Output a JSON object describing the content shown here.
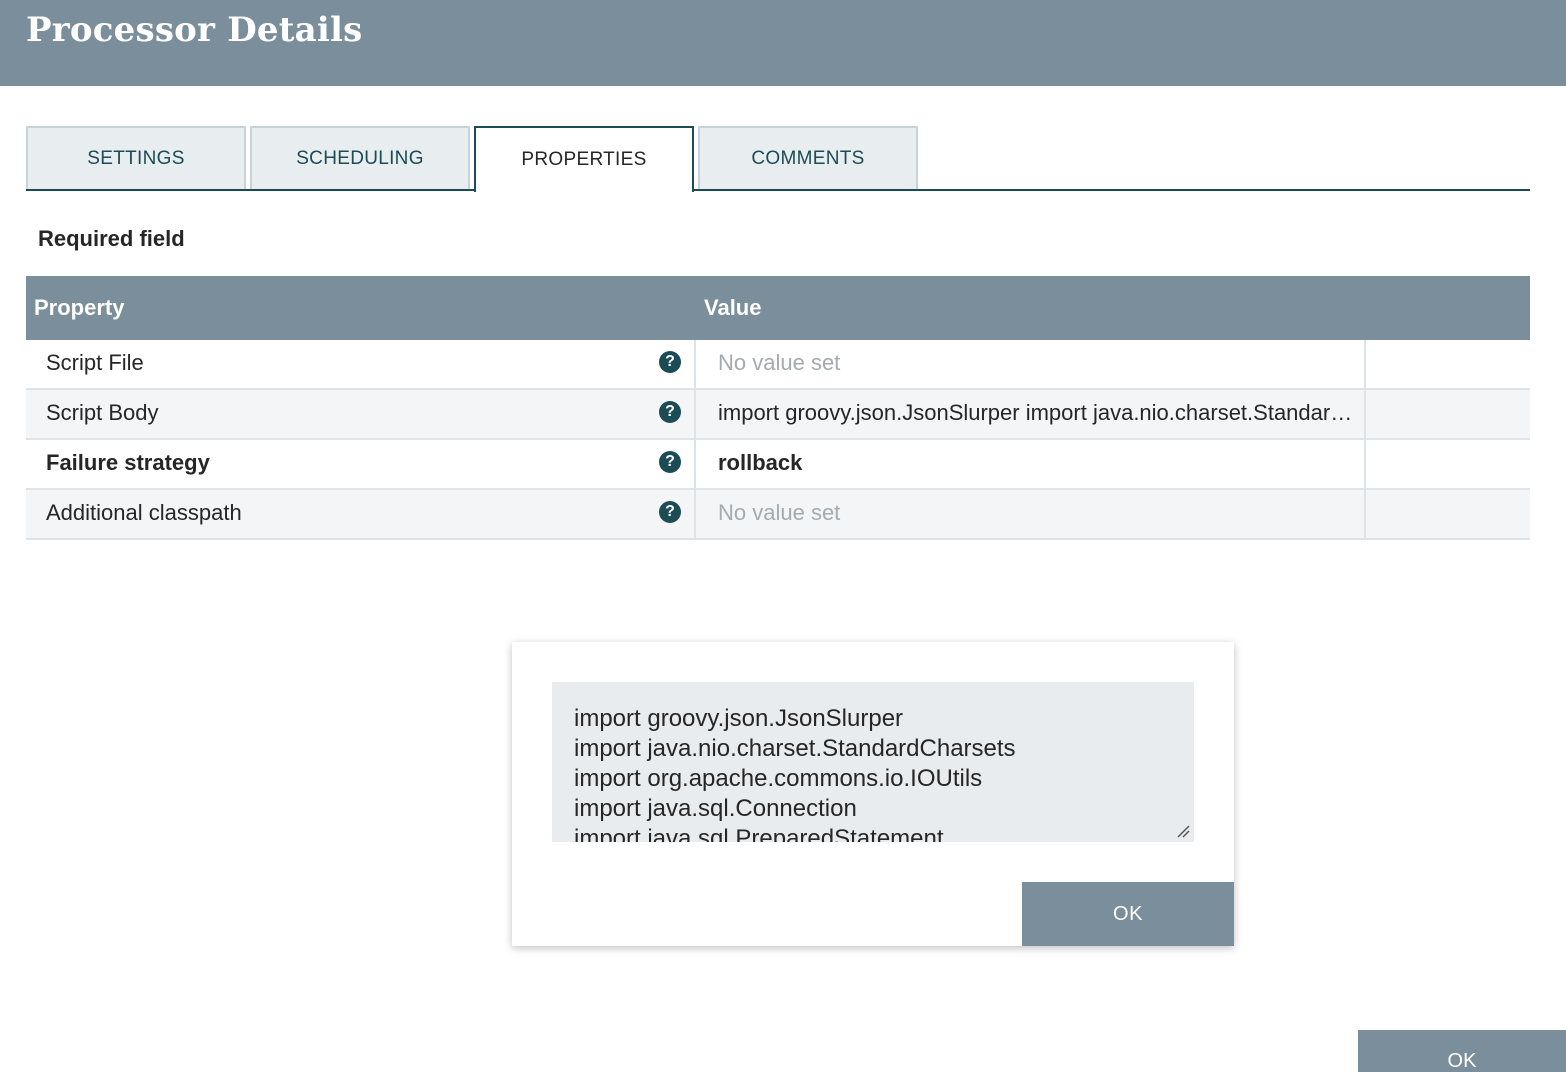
{
  "header": {
    "title": "Processor Details"
  },
  "tabs": [
    {
      "label": "SETTINGS",
      "active": false
    },
    {
      "label": "SCHEDULING",
      "active": false
    },
    {
      "label": "PROPERTIES",
      "active": true
    },
    {
      "label": "COMMENTS",
      "active": false
    }
  ],
  "required_label": "Required field",
  "table": {
    "headers": {
      "property": "Property",
      "value": "Value"
    },
    "rows": [
      {
        "property": "Script File",
        "value": "No value set",
        "required": false,
        "empty": true
      },
      {
        "property": "Script Body",
        "value": "import groovy.json.JsonSlurper import java.nio.charset.StandardCharsets",
        "required": false,
        "empty": false
      },
      {
        "property": "Failure strategy",
        "value": "rollback",
        "required": true,
        "empty": false
      },
      {
        "property": "Additional classpath",
        "value": "No value set",
        "required": false,
        "empty": true
      }
    ]
  },
  "editor": {
    "lines": [
      "import groovy.json.JsonSlurper",
      "import java.nio.charset.StandardCharsets",
      "import org.apache.commons.io.IOUtils",
      "import java.sql.Connection",
      "import java.sql.PreparedStatement"
    ],
    "ok_label": "OK"
  },
  "footer": {
    "ok_label": "OK"
  },
  "icons": {
    "help": "question-circle-icon",
    "resize": "resize-handle-icon"
  },
  "colors": {
    "header_bg": "#7a8e9b",
    "accent": "#1b4c55",
    "button_bg": "#7a8e9b"
  }
}
